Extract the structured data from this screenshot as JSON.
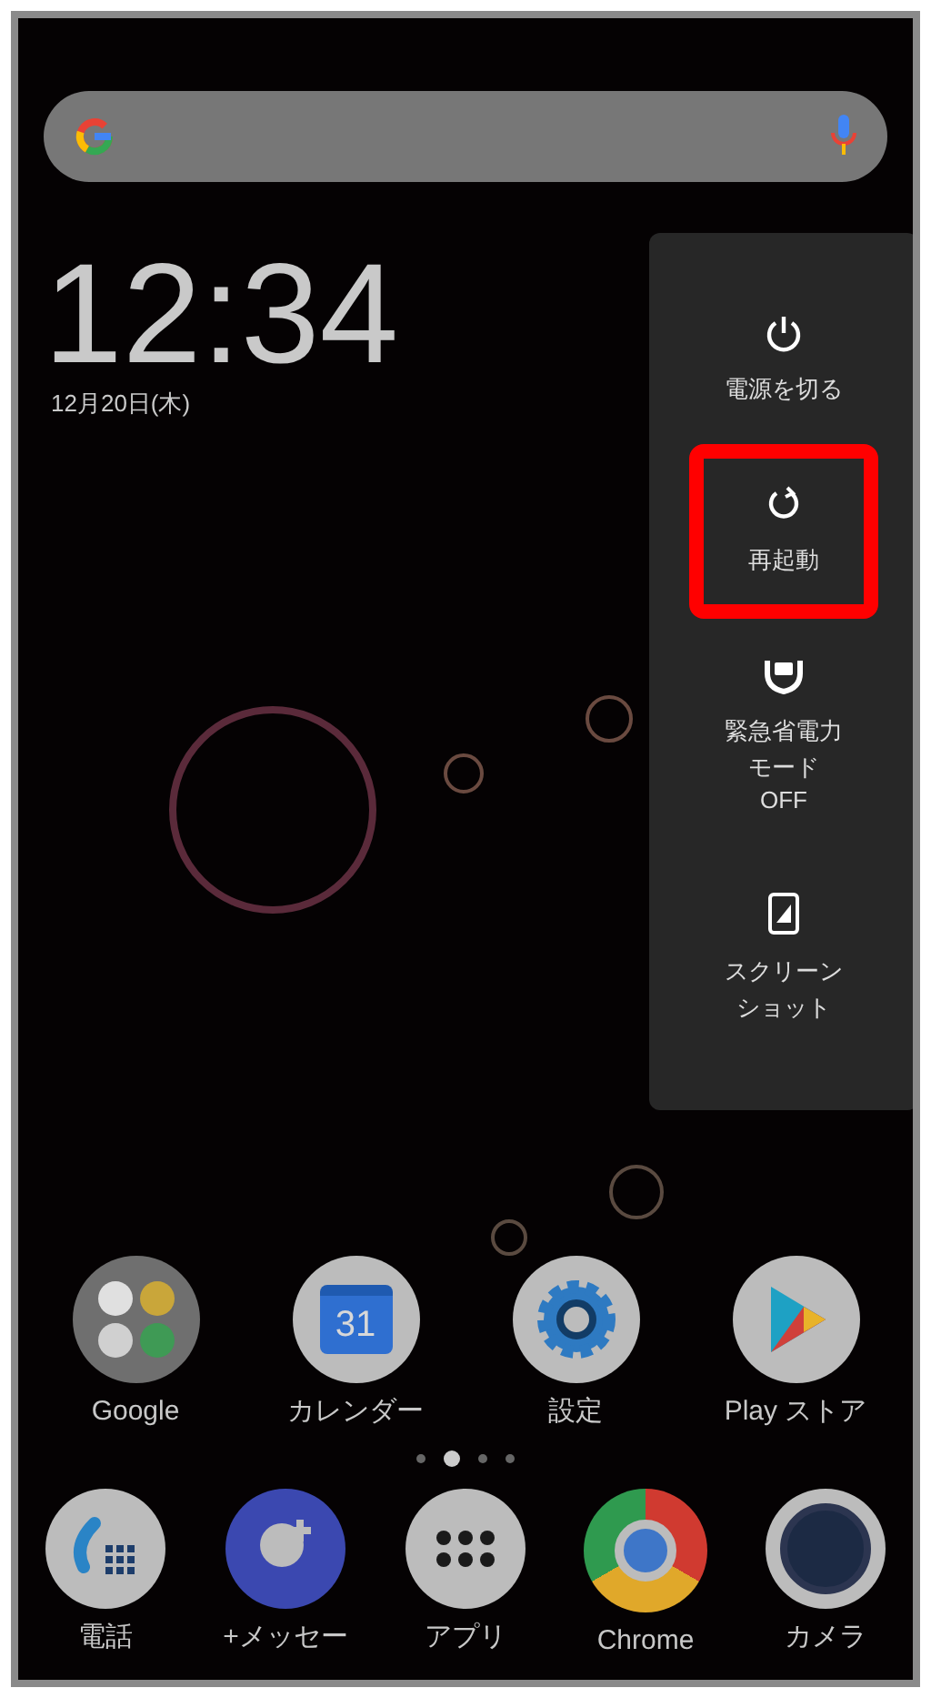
{
  "search_bar": {
    "kind": "google"
  },
  "clock": {
    "time": "12:34",
    "date": "12月20日(木)"
  },
  "power_menu": {
    "items": [
      {
        "kind": "power",
        "label": "電源を切る",
        "highlighted": false
      },
      {
        "kind": "restart",
        "label": "再起動",
        "highlighted": true
      },
      {
        "kind": "saver",
        "label": "緊急省電力モード",
        "status": "OFF",
        "highlighted": false
      },
      {
        "kind": "screenshot",
        "label": "スクリーンショット",
        "highlighted": false
      }
    ]
  },
  "home_apps": [
    {
      "kind": "folder",
      "label": "Google"
    },
    {
      "kind": "calendar",
      "label": "カレンダー",
      "badge": "31"
    },
    {
      "kind": "settings",
      "label": "設定"
    },
    {
      "kind": "play",
      "label": "Play ストア"
    }
  ],
  "page_indicator": [
    {
      "selected": false
    },
    {
      "selected": true
    },
    {
      "selected": false
    },
    {
      "selected": false
    }
  ],
  "dock": [
    {
      "kind": "phone",
      "label": "電話"
    },
    {
      "kind": "message",
      "label": "+メッセー"
    },
    {
      "kind": "apps",
      "label": "アプリ"
    },
    {
      "kind": "chrome",
      "label": "Chrome"
    },
    {
      "kind": "camera",
      "label": "カメラ"
    }
  ]
}
